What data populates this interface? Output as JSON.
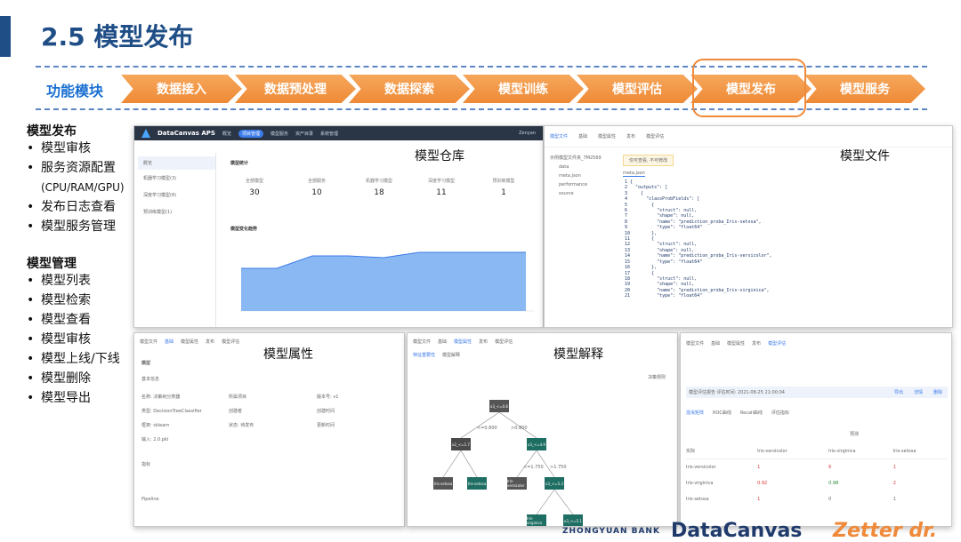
{
  "title": "2.5 模型发布",
  "module_label": "功能模块",
  "flow_steps": [
    "数据接入",
    "数据预处理",
    "数据探索",
    "模型训练",
    "模型评估",
    "模型发布",
    "模型服务"
  ],
  "section1": {
    "title": "模型发布",
    "items": [
      "模型审核",
      "服务资源配置",
      "(CPU/RAM/GPU)",
      "发布日志查看",
      "模型服务管理"
    ]
  },
  "section2": {
    "title": "模型管理",
    "items": [
      "模型列表",
      "模型检索",
      "模型查看",
      "模型审核",
      "模型上线/下线",
      "模型删除",
      "模型导出"
    ]
  },
  "panels": {
    "repo": {
      "label": "模型仓库",
      "brand": "DataCanvas APS",
      "nav": [
        "概览",
        "项目管理",
        "模型服务",
        "资产目录",
        "系统管理"
      ],
      "user": "Zenyan",
      "sidebar": [
        "概览",
        "机器学习模型(3)",
        "深度学习模型(8)",
        "预训练模型(1)"
      ],
      "stats_title": "模型统计",
      "stats": [
        {
          "label": "全部模型",
          "value": "30"
        },
        {
          "label": "全部服务",
          "value": "10"
        },
        {
          "label": "机器学习模型",
          "value": "18"
        },
        {
          "label": "深度学习模型",
          "value": "11"
        },
        {
          "label": "预训练模型",
          "value": "1"
        }
      ],
      "trend_title": "模型变化趋势"
    },
    "files": {
      "label": "模型文件",
      "tabs": [
        "模型文件",
        "基础",
        "模型属性",
        "发布",
        "模型评估"
      ],
      "tree": [
        "示例模型文件夹_7M2569",
        "data",
        "meta.json",
        "performance",
        "source"
      ],
      "notice": "仅可查看, 不可修改",
      "file_tab": "meta.json",
      "code": "1 {\n2   \"outputs\": [\n3     {\n4       \"classProbFields\": [\n5         {\n6           \"struct\": null,\n7           \"shape\": null,\n8           \"name\": \"prediction_proba_Iris-setosa\",\n9           \"type\": \"float64\"\n10        },\n11        {\n12          \"struct\": null,\n13          \"shape\": null,\n14          \"name\": \"prediction_proba_Iris-versicolor\",\n15          \"type\": \"float64\"\n16        },\n17        {\n18          \"struct\": null,\n19          \"shape\": null,\n20          \"name\": \"prediction_proba_Iris-virginica\",\n21          \"type\": \"float64\""
    },
    "props": {
      "label": "模型属性",
      "tabs": [
        "模型文件",
        "基础",
        "模型属性",
        "发布",
        "模型评估"
      ],
      "rows": [
        "模型",
        "基本信息",
        "名称: 决策树分类器",
        "类型: DecisionTreeClassifier",
        "框架: sklearn",
        "输入: 2.0.pkl",
        "指标",
        "Pipeline"
      ],
      "col2": [
        "所属项目",
        "创建者",
        "状态: 待发布"
      ],
      "col3": [
        "版本号: v1",
        "创建时间",
        "更新时间"
      ]
    },
    "explain": {
      "label": "模型解释",
      "tabs": [
        "模型文件",
        "基础",
        "模型属性",
        "发布",
        "模型评估"
      ],
      "sub_tabs": [
        "特征重要性",
        "模型解释"
      ],
      "nodes": [
        "x3_<=0.8",
        "x2_<=1.7",
        "x3_<=4.9",
        "Iris-setosa",
        "Iris-setosa",
        "Iris-versicolor",
        "x3_<=5.3",
        "Iris-virginica",
        "x3_<=5.1"
      ],
      "edge_labels": [
        "<=0.800",
        ">0.800",
        "<=1.750",
        ">1.750"
      ],
      "side_label": "决策规则"
    },
    "publish": {
      "label": "发布",
      "tabs": [
        "模型文件",
        "基础",
        "模型属性",
        "发布",
        "模型评估"
      ],
      "info": "模型评估报告   评估时间: 2021-08-25 21:00:04",
      "actions": [
        "导出",
        "详情",
        "删除"
      ],
      "sub_tabs": [
        "混淆矩阵",
        "ROC曲线",
        "Recall曲线",
        "评估指标"
      ],
      "matrix_header": [
        "实际",
        "Iris-versicolor",
        "Iris-virginica",
        "Iris-setosa"
      ],
      "matrix_top": "预测",
      "matrix_rows": [
        [
          "Iris-versicolor",
          "1",
          "6",
          "1"
        ],
        [
          "Iris-virginica",
          "0.92",
          "0.98",
          "2"
        ],
        [
          "Iris-setosa",
          "1",
          "0",
          "1"
        ]
      ]
    }
  },
  "footer": {
    "bank": "ZHONGYUAN BANK",
    "dc": "DataCanvas",
    "partner": "Zetter dr."
  },
  "colors": {
    "title": "#1f4e87",
    "accent_orange": "#ee8a36",
    "module_blue": "#1a6fd1",
    "dark_nav": "#2a3646",
    "tree_green": "#1f6e63"
  }
}
